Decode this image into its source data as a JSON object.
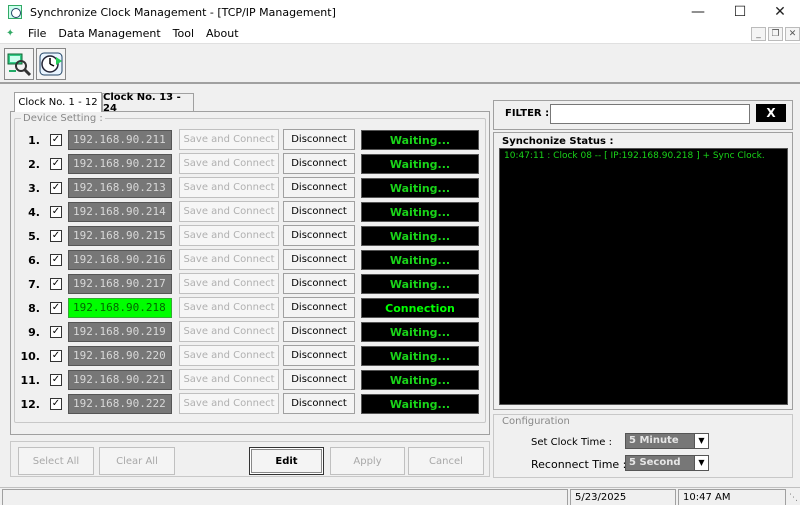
{
  "window": {
    "title": "Synchronize Clock Management - [TCP/IP Management]",
    "minimize": "—",
    "maximize": "☐",
    "close": "✕"
  },
  "menu": {
    "items": [
      "File",
      "Data Management",
      "Tool",
      "About"
    ],
    "mdi_minimize": "_",
    "mdi_restore": "❐",
    "mdi_close": "✕"
  },
  "toolbar": {
    "icons": [
      "search-network-icon",
      "sync-clock-icon"
    ]
  },
  "tabs": [
    {
      "label": "Clock No. 1 - 12",
      "active": true
    },
    {
      "label": "Clock No. 13 - 24",
      "active": false
    }
  ],
  "device_setting": {
    "legend": "Device Setting :",
    "save_label": "Save and Connect",
    "disconnect_label": "Disconnect",
    "rows": [
      {
        "num": "1.",
        "checked": true,
        "ip": "192.168.90.211",
        "status": "Waiting...",
        "connected": false
      },
      {
        "num": "2.",
        "checked": true,
        "ip": "192.168.90.212",
        "status": "Waiting...",
        "connected": false
      },
      {
        "num": "3.",
        "checked": true,
        "ip": "192.168.90.213",
        "status": "Waiting...",
        "connected": false
      },
      {
        "num": "4.",
        "checked": true,
        "ip": "192.168.90.214",
        "status": "Waiting...",
        "connected": false
      },
      {
        "num": "5.",
        "checked": true,
        "ip": "192.168.90.215",
        "status": "Waiting...",
        "connected": false
      },
      {
        "num": "6.",
        "checked": true,
        "ip": "192.168.90.216",
        "status": "Waiting...",
        "connected": false
      },
      {
        "num": "7.",
        "checked": true,
        "ip": "192.168.90.217",
        "status": "Waiting...",
        "connected": false
      },
      {
        "num": "8.",
        "checked": true,
        "ip": "192.168.90.218",
        "status": "Connection",
        "connected": true
      },
      {
        "num": "9.",
        "checked": true,
        "ip": "192.168.90.219",
        "status": "Waiting...",
        "connected": false
      },
      {
        "num": "10.",
        "checked": true,
        "ip": "192.168.90.220",
        "status": "Waiting...",
        "connected": false
      },
      {
        "num": "11.",
        "checked": true,
        "ip": "192.168.90.221",
        "status": "Waiting...",
        "connected": false
      },
      {
        "num": "12.",
        "checked": true,
        "ip": "192.168.90.222",
        "status": "Waiting...",
        "connected": false
      }
    ]
  },
  "actions": {
    "select_all": "Select All",
    "clear_all": "Clear All",
    "edit": "Edit",
    "apply": "Apply",
    "cancel": "Cancel"
  },
  "filter": {
    "label": "FILTER :",
    "value": "",
    "clear": "X"
  },
  "sync_status": {
    "label": "Synchonize Status :",
    "log": [
      "10:47:11 : Clock 08 -- [ IP:192.168.90.218 ] + Sync Clock."
    ]
  },
  "configuration": {
    "legend": "Configuration",
    "set_clock_label": "Set Clock Time :",
    "set_clock_value": "5 Minute",
    "reconnect_label": "Reconnect Time :",
    "reconnect_value": "5 Second"
  },
  "statusbar": {
    "date": "5/23/2025",
    "time": "10:47 AM"
  },
  "colors": {
    "status_text": "#19d419",
    "connected_ip_bg": "#00ff00",
    "ip_bg": "#777777",
    "status_bg": "#000000"
  }
}
